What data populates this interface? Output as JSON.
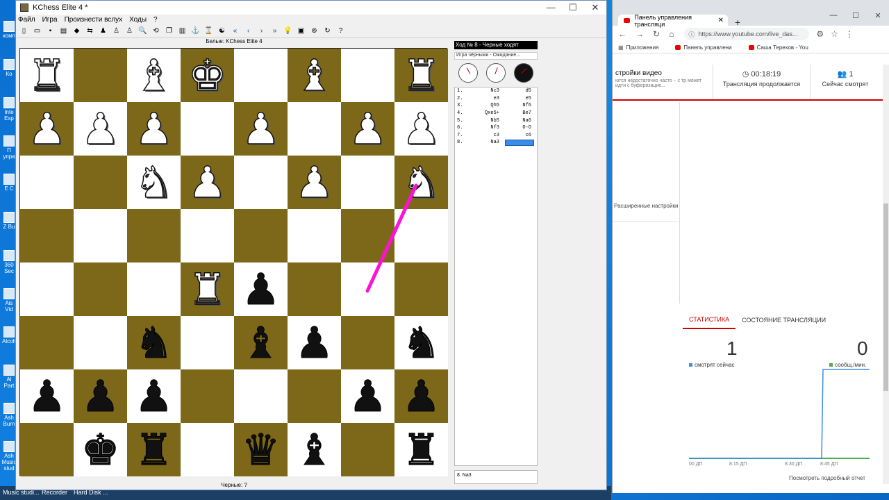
{
  "desktop": {
    "icons": [
      "комп",
      "Ко",
      "Inte Exp",
      "П упра",
      "Е С",
      "Z Bu",
      "360 Sec",
      "Ais Vid",
      "Alcoh",
      "Al Part",
      "Ash Burn",
      "Ash Music stud"
    ],
    "taskbar_items": [
      "Music studi...",
      "Recorder",
      "Hard Disk ..."
    ]
  },
  "chess": {
    "title": "KChess Elite 4 *",
    "menu": [
      "Файл",
      "Игра",
      "Произнести вслух",
      "Ходы",
      "?"
    ],
    "board_header": "Белые: KChess Elite 4",
    "board_footer": "Черные: ?",
    "move_header": "Ход № 8 - Черные ходят",
    "status": "Игра чёрными - Ожидание...",
    "last_move_box": "8. Na3",
    "board": [
      [
        "wR",
        "",
        "wB",
        "wK",
        "",
        "wB",
        "",
        "wR"
      ],
      [
        "wP",
        "wP",
        "wP",
        "",
        "wP",
        "",
        "wP",
        "wP"
      ],
      [
        "",
        "",
        "wN",
        "wP",
        "",
        "wP",
        "",
        "wN"
      ],
      [
        "",
        "",
        "",
        "",
        "",
        "",
        "",
        ""
      ],
      [
        "",
        "",
        "",
        "wR",
        "bP",
        "",
        "",
        ""
      ],
      [
        "",
        "",
        "bN",
        "",
        "bB",
        "bP",
        "",
        "bN"
      ],
      [
        "bP",
        "bP",
        "bP",
        "",
        "",
        "",
        "bP",
        "bP"
      ],
      [
        "",
        "bK",
        "bR",
        "",
        "bQ",
        "bB",
        "",
        "bR"
      ]
    ],
    "moves": [
      {
        "n": "1.",
        "w": "Nc3",
        "b": "d5"
      },
      {
        "n": "2.",
        "w": "e3",
        "b": "e5"
      },
      {
        "n": "3.",
        "w": "Qh5",
        "b": "Nf6"
      },
      {
        "n": "4.",
        "w": "Qxe5+",
        "b": "Be7"
      },
      {
        "n": "5.",
        "w": "Nb5",
        "b": "Na6"
      },
      {
        "n": "6.",
        "w": "Nf3",
        "b": "O-O"
      },
      {
        "n": "7.",
        "w": "c3",
        "b": "c6"
      },
      {
        "n": "8.",
        "w": "Na3",
        "b": ""
      }
    ],
    "arrow_color": "#ff10d8"
  },
  "browser": {
    "tab_title": "Панель управления трансляци",
    "url": "https://www.youtube.com/live_das...",
    "bookmarks": [
      "Приложения",
      "Панель управлени",
      "Саша Терехов - You"
    ],
    "settings_title": "стройки видео",
    "settings_note": "ются недостаточно часто – с тр может идти с буферизацие...",
    "duration": "00:18:19",
    "duration_label": "Трансляция продолжается",
    "viewers": "1",
    "viewers_label": "Сейчас смотрят",
    "advanced": "Расширенные настройки",
    "tab_stats": "СТАТИСТИКА",
    "tab_state": "СОСТОЯНИЕ ТРАНСЛЯЦИИ",
    "watching_now_value": "1",
    "watching_now_label": "смотрят сейчас",
    "messages_value": "0",
    "messages_label": "сообщ./мин.",
    "x_ticks": [
      "00 ДП",
      "8:15 ДП",
      "8:30 ДП",
      "8:45 ДП"
    ],
    "report_link": "Посмотреть подробный отчет",
    "accent": "#cc0000"
  }
}
